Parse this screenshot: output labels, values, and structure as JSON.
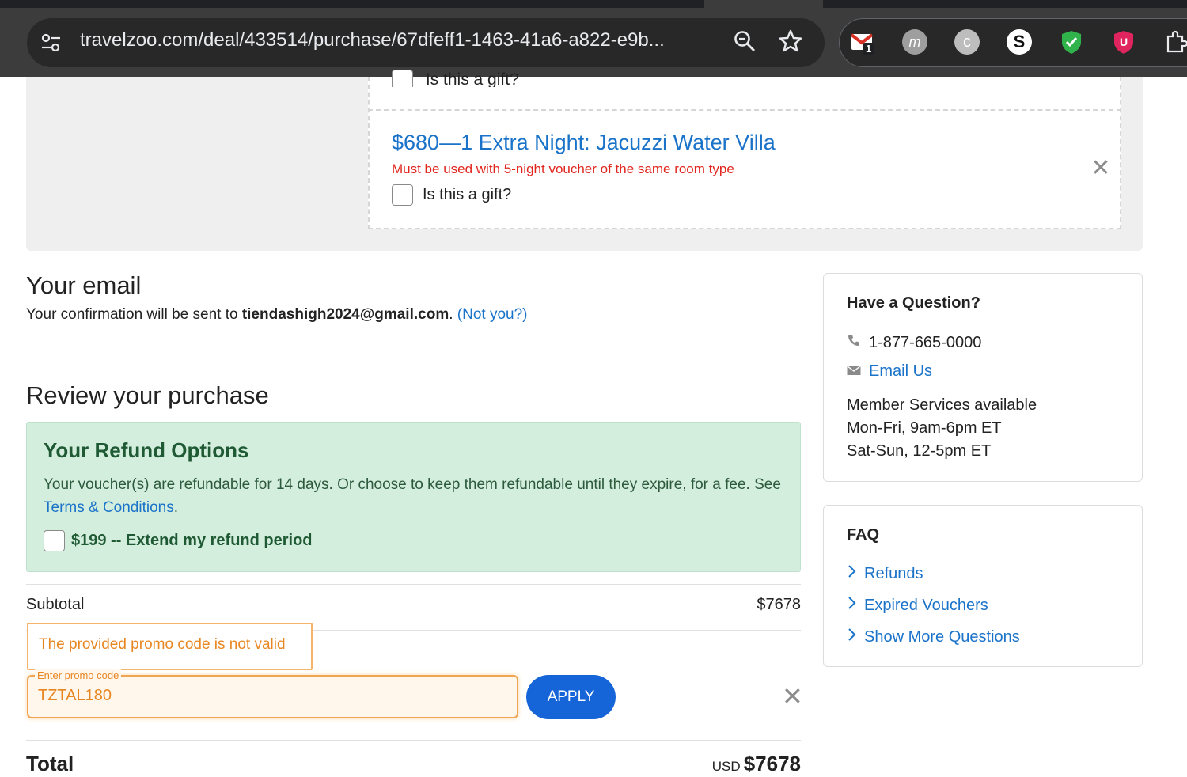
{
  "browser": {
    "url": "travelzoo.com/deal/433514/purchase/67dfeff1-1463-41a6-a822-e9b...",
    "extensions": [
      {
        "name": "gmail-extension",
        "badge": "1",
        "color": "#d93025"
      },
      {
        "name": "m-extension",
        "color": "#9e9e9e"
      },
      {
        "name": "c-extension",
        "color": "#bdbdbd"
      },
      {
        "name": "s-extension",
        "color": "#ffffff"
      },
      {
        "name": "shield-extension",
        "color": "#2fb34a"
      },
      {
        "name": "u-extension",
        "color": "#e0245e"
      },
      {
        "name": "puzzle-extension",
        "color": "#e8eaed"
      }
    ]
  },
  "gift_section": {
    "prev_gift_label": "Is this a gift?",
    "deal_title": "$680—1 Extra Night: Jacuzzi Water Villa",
    "deal_note": "Must be used with 5-night voucher of the same room type",
    "gift_label": "Is this a gift?"
  },
  "email": {
    "heading": "Your email",
    "prefix": "Your confirmation will be sent to ",
    "address": "tiendashigh2024@gmail.com",
    "suffix": ". ",
    "not_you": "(Not you?)"
  },
  "review": {
    "heading": "Review your purchase",
    "refund": {
      "title": "Your Refund Options",
      "text": "Your voucher(s) are refundable for 14 days. Or choose to keep them refundable until they expire, for a fee. See ",
      "terms_link": "Terms & Conditions",
      "text_end": ".",
      "option_label": "$199 -- Extend my refund period"
    },
    "subtotal_label": "Subtotal",
    "subtotal_value": "$7678",
    "promo": {
      "error": "The provided promo code is not valid",
      "placeholder": "Enter promo code",
      "value": "TZTAL180",
      "apply_label": "APPLY"
    },
    "total_label": "Total",
    "total_currency": "USD",
    "total_value": "$7678"
  },
  "sidebar": {
    "question": {
      "title": "Have a Question?",
      "phone": "1-877-665-0000",
      "email_link": "Email Us",
      "hours": [
        "Member Services available",
        "Mon-Fri, 9am-6pm ET",
        "Sat-Sun, 12-5pm ET"
      ]
    },
    "faq": {
      "title": "FAQ",
      "items": [
        "Refunds",
        "Expired Vouchers",
        "Show More Questions"
      ]
    }
  }
}
